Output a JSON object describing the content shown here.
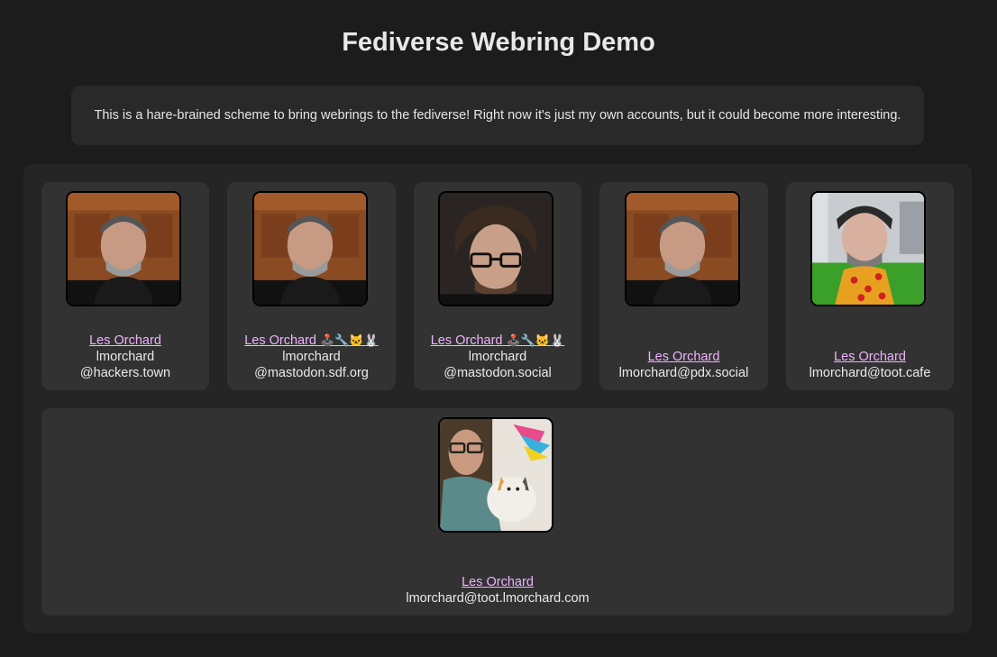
{
  "page": {
    "title": "Fediverse Webring Demo",
    "intro": "This is a hare-brained scheme to bring webrings to the fediverse! Right now it's just my own accounts, but it could become more interesting."
  },
  "accounts": [
    {
      "name": "Les Orchard",
      "handle_line1": "lmorchard",
      "handle_line2": "@hackers.town",
      "avatar": "avatar-wood-door"
    },
    {
      "name": "Les Orchard ",
      "emoji": "🕹️🔧🐱🐰",
      "handle_line1": "lmorchard",
      "handle_line2": "@mastodon.sdf.org",
      "avatar": "avatar-wood-door"
    },
    {
      "name": "Les Orchard ",
      "emoji": "🕹️🔧🐱🐰",
      "handle_line1": "lmorchard",
      "handle_line2": "@mastodon.social",
      "avatar": "avatar-glasses-dark"
    },
    {
      "name": "Les Orchard",
      "handle_line1": "lmorchard@pdx.social",
      "avatar": "avatar-wood-door"
    },
    {
      "name": "Les Orchard",
      "handle_line1": "lmorchard@toot.cafe",
      "avatar": "avatar-pizza-shirt"
    },
    {
      "name": "Les Orchard",
      "handle_line1": "lmorchard@toot.lmorchard.com",
      "avatar": "avatar-cat"
    }
  ],
  "colors": {
    "background": "#1c1c1c",
    "panel": "#252525",
    "card": "#323232",
    "link": "#f0b3ff"
  }
}
